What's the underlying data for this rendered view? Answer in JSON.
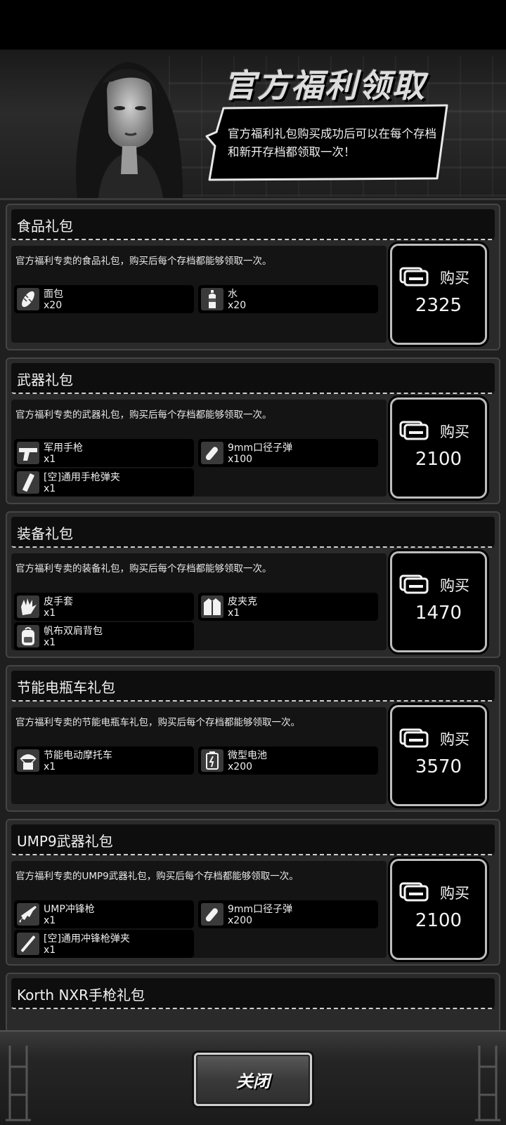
{
  "header": {
    "title": "官方福利领取",
    "notice": "官方福利礼包购买成功后可以在每个存档和新开存档都领取一次！"
  },
  "buy_label": "购买",
  "packs": [
    {
      "title": "食品礼包",
      "desc": "官方福利专卖的食品礼包，购买后每个存档都能够领取一次。",
      "items": [
        {
          "name": "面包",
          "qty": "x20",
          "icon": "bread-icon"
        },
        {
          "name": "水",
          "qty": "x20",
          "icon": "water-bottle-icon"
        }
      ],
      "price": "2325"
    },
    {
      "title": "武器礼包",
      "desc": "官方福利专卖的武器礼包，购买后每个存档都能够领取一次。",
      "items": [
        {
          "name": "军用手枪",
          "qty": "x1",
          "icon": "pistol-icon"
        },
        {
          "name": "9mm口径子弹",
          "qty": "x100",
          "icon": "bullet-icon"
        },
        {
          "name": "[空]通用手枪弹夹",
          "qty": "x1",
          "icon": "magazine-icon"
        }
      ],
      "price": "2100"
    },
    {
      "title": "装备礼包",
      "desc": "官方福利专卖的装备礼包，购买后每个存档都能够领取一次。",
      "items": [
        {
          "name": "皮手套",
          "qty": "x1",
          "icon": "glove-icon"
        },
        {
          "name": "皮夹克",
          "qty": "x1",
          "icon": "jacket-icon"
        },
        {
          "name": "帆布双肩背包",
          "qty": "x1",
          "icon": "backpack-icon"
        }
      ],
      "price": "1470"
    },
    {
      "title": "节能电瓶车礼包",
      "desc": "官方福利专卖的节能电瓶车礼包，购买后每个存档都能够领取一次。",
      "items": [
        {
          "name": "节能电动摩托车",
          "qty": "x1",
          "icon": "scooter-airdrop-icon"
        },
        {
          "name": "微型电池",
          "qty": "x200",
          "icon": "battery-icon"
        }
      ],
      "price": "3570"
    },
    {
      "title": "UMP9武器礼包",
      "desc": "官方福利专卖的UMP9武器礼包，购买后每个存档都能够领取一次。",
      "items": [
        {
          "name": "UMP冲锋枪",
          "qty": "x1",
          "icon": "smg-icon"
        },
        {
          "name": "9mm口径子弹",
          "qty": "x200",
          "icon": "bullet-icon"
        },
        {
          "name": "[空]通用冲锋枪弹夹",
          "qty": "x1",
          "icon": "magazine-icon"
        }
      ],
      "price": "2100"
    },
    {
      "title": "Korth NXR手枪礼包"
    }
  ],
  "footer": {
    "close_label": "关闭"
  },
  "colors": {
    "panel": "#2a2a2a",
    "dark": "#0e0e0e",
    "border": "#bdbdbd"
  }
}
